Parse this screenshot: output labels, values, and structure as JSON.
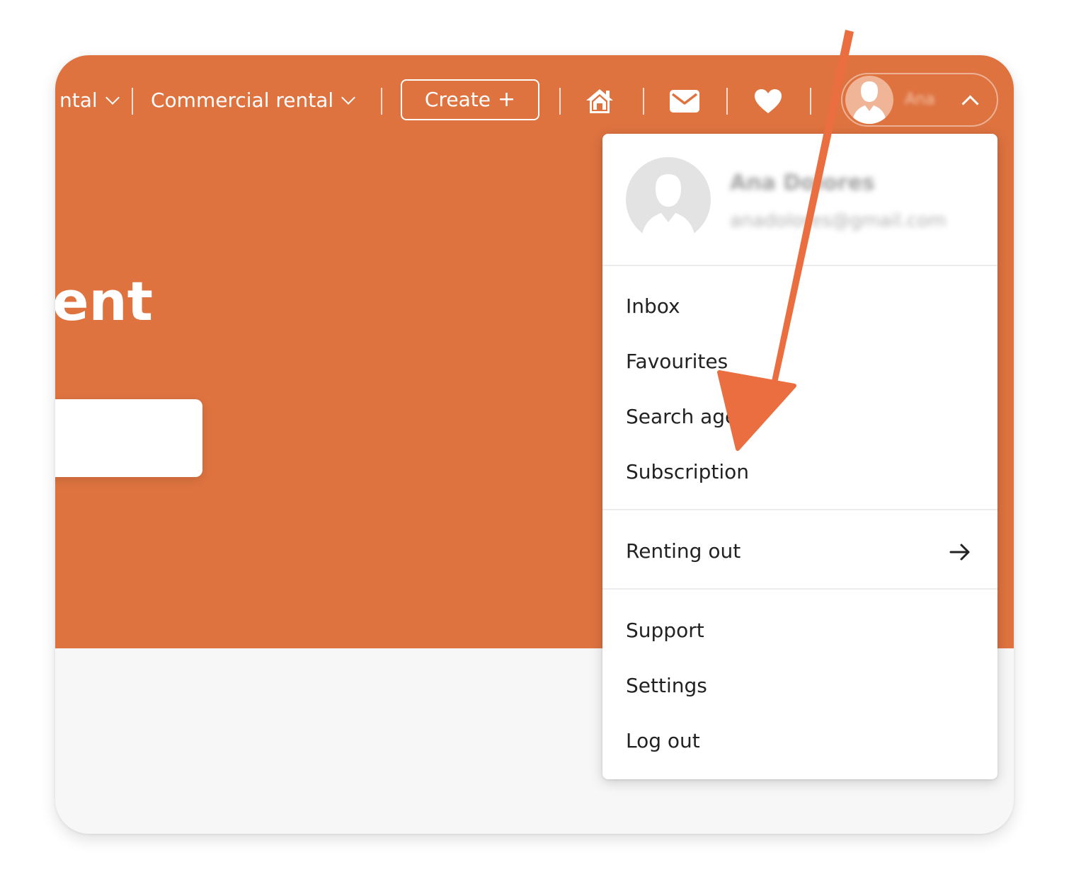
{
  "nav": {
    "items": [
      {
        "label": "ntal"
      },
      {
        "label": "Commercial rental"
      }
    ],
    "create_label": "Create",
    "create_plus": "+",
    "icons": [
      "home-icon",
      "mail-icon",
      "heart-icon"
    ]
  },
  "profile": {
    "short_name": "Ana",
    "full_name": "Ana Dolores",
    "email": "anadolores@gmail.com"
  },
  "hero": {
    "heading": "ent"
  },
  "menu": {
    "items": [
      "Inbox",
      "Favourites",
      "Search agent",
      "Subscription"
    ],
    "renting_out": "Renting out",
    "footer_items": [
      "Support",
      "Settings",
      "Log out"
    ]
  },
  "colors": {
    "brand": "#de7340",
    "annotation_arrow": "#ea6e3f",
    "page_bg": "#f7f7f7"
  }
}
